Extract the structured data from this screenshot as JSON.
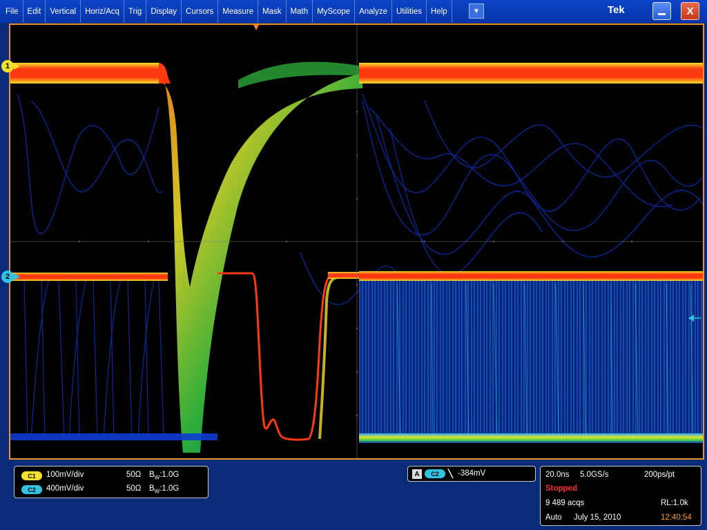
{
  "menu": {
    "items": [
      "File",
      "Edit",
      "Vertical",
      "Horiz/Acq",
      "Trig",
      "Display",
      "Cursors",
      "Measure",
      "Mask",
      "Math",
      "MyScope",
      "Analyze",
      "Utilities",
      "Help"
    ],
    "dropdown_glyph": "▼"
  },
  "window": {
    "logo": "Tek",
    "close_glyph": "X"
  },
  "colors": {
    "ch1": "#f4e02c",
    "ch2": "#33c3e2",
    "graticule_border": "#e8942a",
    "menu_bg": "#0a3fc0"
  },
  "markers": {
    "ch1": "1",
    "ch2": "2"
  },
  "vertical": {
    "ch1": {
      "label": "C1",
      "scale": "100mV/div",
      "impedance": "50Ω",
      "bw_prefix": "B",
      "bw_sub": "W",
      "bw_value": ":1.0G"
    },
    "ch2": {
      "label": "C2",
      "scale": "400mV/div",
      "impedance": "50Ω",
      "bw_prefix": "B",
      "bw_sub": "W",
      "bw_value": ":1.0G"
    }
  },
  "trigger": {
    "mode_label": "A",
    "source": "C2",
    "slope_glyph": "╲",
    "level": "-384mV"
  },
  "horizontal": {
    "timebase": "20.0ns",
    "sample_rate": "5.0GS/s",
    "resolution": "200ps/pt",
    "status": "Stopped",
    "acqs": "9 489 acqs",
    "record_length": "RL:1.0k",
    "trigger_mode": "Auto",
    "date": "July 15, 2010",
    "time": "12:40:54"
  }
}
